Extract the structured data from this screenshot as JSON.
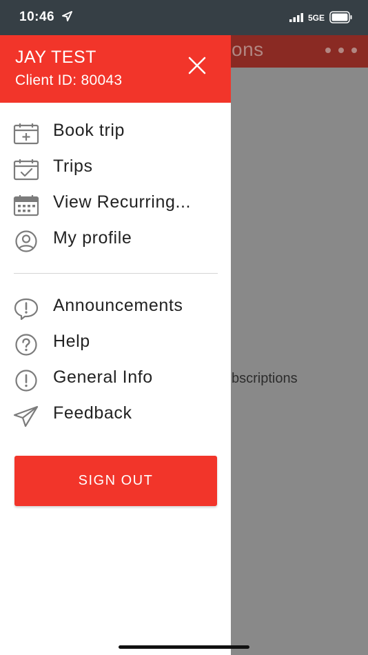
{
  "status_bar": {
    "time": "10:46",
    "network": "5GE"
  },
  "background_screen": {
    "title_fragment": "ons",
    "body_fragment": "bscriptions"
  },
  "drawer": {
    "user_name": "JAY TEST",
    "client_id": "Client ID: 80043",
    "primary_items": [
      {
        "label": "Book trip",
        "icon": "calendar-plus-icon"
      },
      {
        "label": "Trips",
        "icon": "calendar-check-icon"
      },
      {
        "label": "View Recurring...",
        "icon": "calendar-grid-icon"
      },
      {
        "label": "My profile",
        "icon": "user-circle-icon"
      }
    ],
    "secondary_items": [
      {
        "label": "Announcements",
        "icon": "speech-exclamation-icon"
      },
      {
        "label": "Help",
        "icon": "question-circle-icon"
      },
      {
        "label": "General Info",
        "icon": "info-exclamation-icon"
      },
      {
        "label": "Feedback",
        "icon": "paper-plane-icon"
      }
    ],
    "sign_out_label": "SIGN OUT"
  },
  "colors": {
    "brand_red": "#f2352a",
    "status_bar_bg": "#363f45",
    "icon_gray": "#7b7b7b"
  }
}
